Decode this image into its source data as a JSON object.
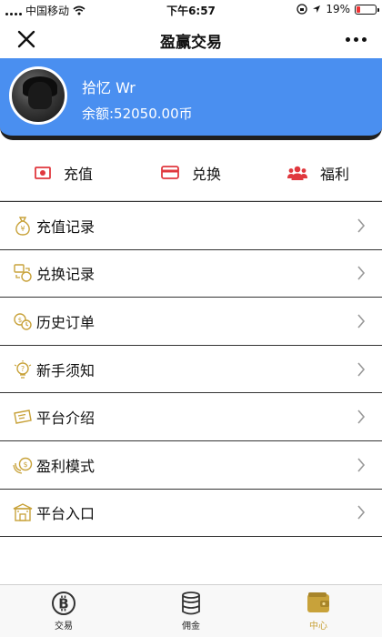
{
  "status": {
    "carrier": "中国移动",
    "time": "下午6:57",
    "battery": "19%",
    "battery_level": 0.19
  },
  "header": {
    "title": "盈赢交易"
  },
  "profile": {
    "name": "拾忆 Wr",
    "balance": "余额:52050.00币"
  },
  "actions": [
    {
      "label": "充值",
      "icon": "cash-icon"
    },
    {
      "label": "兑换",
      "icon": "card-icon"
    },
    {
      "label": "福利",
      "icon": "people-icon"
    }
  ],
  "menu": [
    {
      "label": "充值记录",
      "icon": "money-bag-icon"
    },
    {
      "label": "兑换记录",
      "icon": "exchange-icon"
    },
    {
      "label": "历史订单",
      "icon": "coin-clock-icon"
    },
    {
      "label": "新手须知",
      "icon": "question-bulb-icon"
    },
    {
      "label": "平台介绍",
      "icon": "ticket-icon"
    },
    {
      "label": "盈利模式",
      "icon": "coins-icon"
    },
    {
      "label": "平台入口",
      "icon": "building-icon"
    }
  ],
  "tabs": [
    {
      "label": "交易",
      "icon": "bitcoin-icon"
    },
    {
      "label": "佣金",
      "icon": "coin-stack-icon"
    },
    {
      "label": "中心",
      "icon": "wallet-icon",
      "active": true
    }
  ],
  "colors": {
    "banner": "#4a8ff0",
    "gold": "#c8a23a",
    "red": "#e0383e"
  }
}
